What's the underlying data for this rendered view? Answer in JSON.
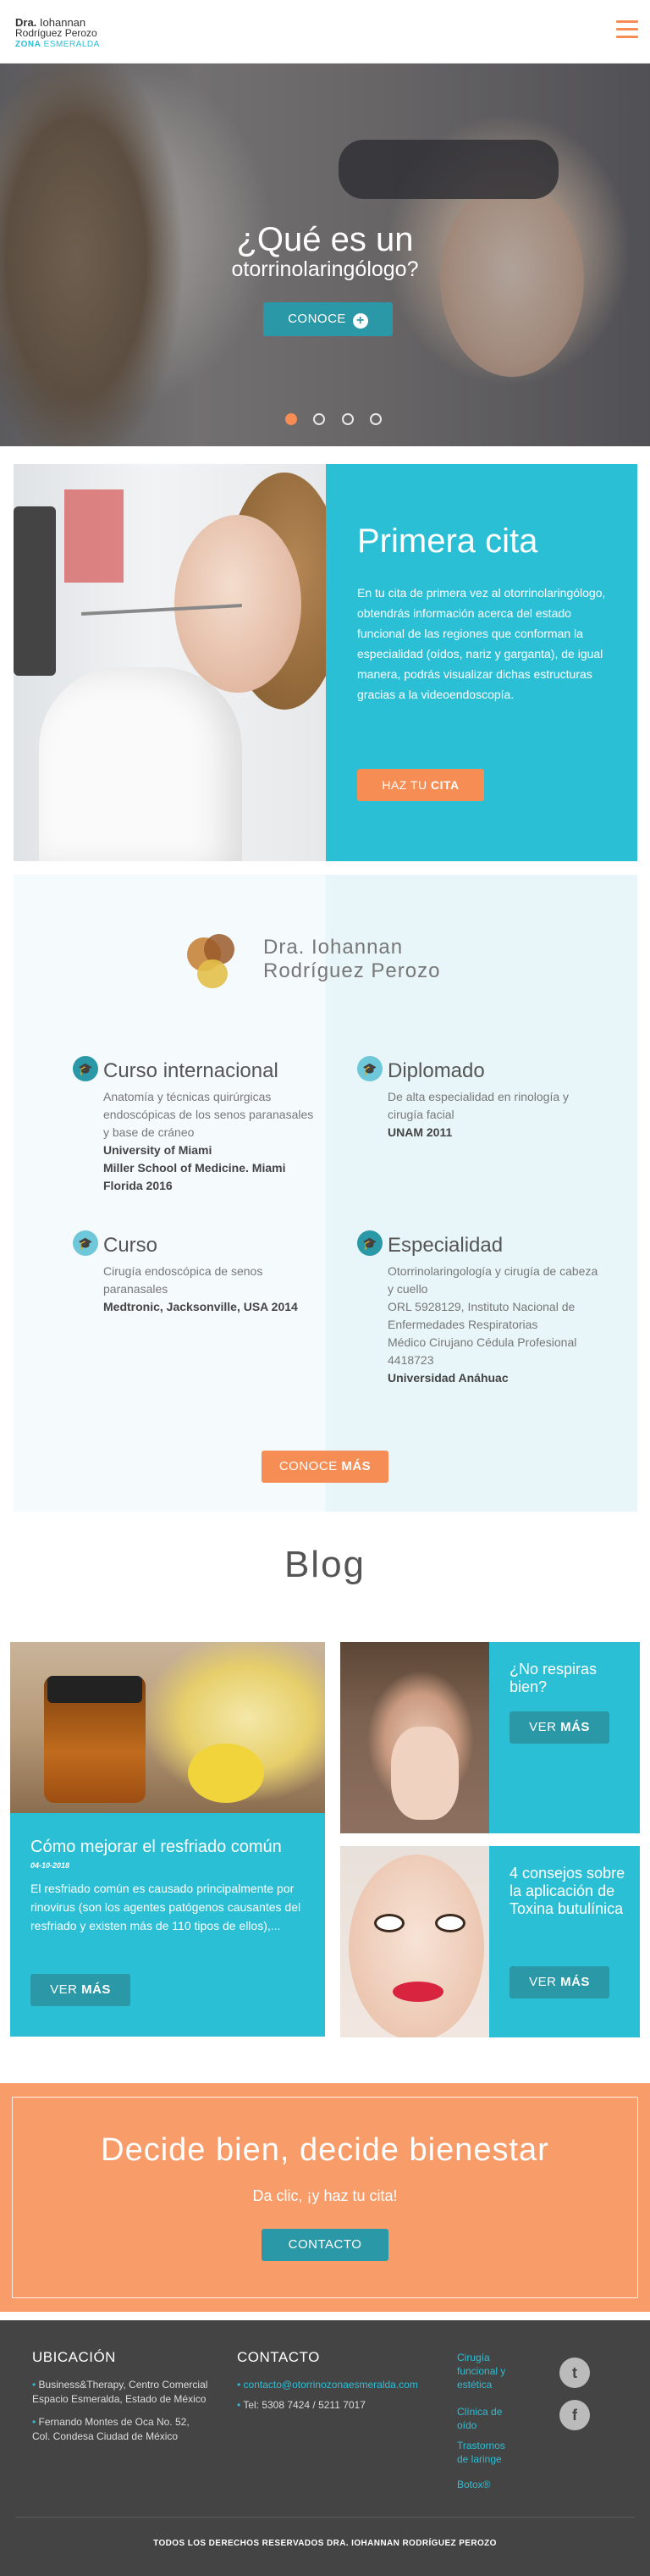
{
  "header": {
    "logo_name_bold": "Dra.",
    "logo_name_rest": "Iohannan",
    "logo_line2": "Rodríguez Perozo",
    "logo_zone_bold": "ZONA",
    "logo_zone_rest": "ESMERALDA"
  },
  "hero": {
    "title": "¿Qué es un",
    "subtitle": "otorrinolaringólogo?",
    "button_label": "CONOCE",
    "button_icon": "plus-circle-icon",
    "slides": 4,
    "active_slide": 1
  },
  "cita": {
    "title": "Primera cita",
    "text": "En tu cita de primera vez al otorrinolaringólogo, obtendrás información acerca del estado funcional de las regiones que conforman la especialidad (oídos, nariz y garganta), de igual manera, podrás visualizar dichas estructuras gracias a la videoendoscopía.",
    "button_pre": "HAZ TU",
    "button_bold": "CITA"
  },
  "doctor": {
    "name_line1": "Dra.  Iohannan",
    "name_line2": "Rodríguez  Perozo",
    "credentials": [
      {
        "heading": "Curso internacional",
        "text": "Anatomía y técnicas quirúrgicas endoscópicas de los senos paranasales y base de cráneo",
        "strong": "University of Miami\nMiller School of Medicine. Miami Florida 2016",
        "icon": "graduation-cap-icon"
      },
      {
        "heading": "Diplomado",
        "text": "De alta especialidad en rinología y cirugía facial",
        "strong": "UNAM 2011",
        "icon": "graduation-cap-icon"
      },
      {
        "heading": "Curso",
        "text": "Cirugía endoscópica de senos paranasales",
        "strong": "Medtronic, Jacksonville, USA 2014",
        "icon": "graduation-cap-icon"
      },
      {
        "heading": "Especialidad",
        "text": "Otorrinolaringología y cirugía de cabeza y cuello\nORL 5928129, Instituto Nacional de Enfermedades Respiratorias\nMédico Cirujano Cédula Profesional 4418723",
        "strong": "Universidad Anáhuac",
        "icon": "graduation-cap-icon"
      }
    ],
    "button_pre": "CONOCE",
    "button_bold": "MÁS"
  },
  "blog": {
    "title": "Blog",
    "featured": {
      "title": "Cómo mejorar el resfriado común",
      "date": "04-10-2018",
      "text": "El resfriado común es causado principalmente por rinovirus (son los agentes patógenos causantes del resfriado y existen más de 110 tipos de ellos),...",
      "button_pre": "VER",
      "button_bold": "MÁS"
    },
    "posts": [
      {
        "title": "¿No respiras bien?",
        "button_pre": "VER",
        "button_bold": "MÁS"
      },
      {
        "title": "4 consejos sobre la aplicación de Toxina butulínica",
        "button_pre": "VER",
        "button_bold": "MÁS"
      }
    ]
  },
  "cta": {
    "title": "Decide bien, decide bienestar",
    "subtitle": "Da clic, ¡y haz tu cita!",
    "button_label": "CONTACTO"
  },
  "footer": {
    "location_heading": "UBICACIÓN",
    "location_items": [
      "Business&Therapy, Centro Comercial Espacio Esmeralda, Estado de México",
      "Fernando Montes de Oca No. 52, Col. Condesa Ciudad de México"
    ],
    "contact_heading": "CONTACTO",
    "contact_email": "contacto@otorrinozonaesmeralda.com",
    "contact_phone": "Tel: 5308 7424 / 5211 7017",
    "links": [
      "Cirugía funcional y estética",
      "Clínica de oído",
      "Trastornos de laringe",
      "Botox®"
    ],
    "social": [
      "twitter-icon",
      "facebook-icon"
    ],
    "copyright": "TODOS LOS DERECHOS RESERVADOS DRA. IOHANNAN RODRÍGUEZ PEROZO"
  },
  "colors": {
    "teal": "#2bbfd6",
    "dark_teal": "#2a98a6",
    "orange": "#f58d55",
    "footer": "#444444"
  }
}
